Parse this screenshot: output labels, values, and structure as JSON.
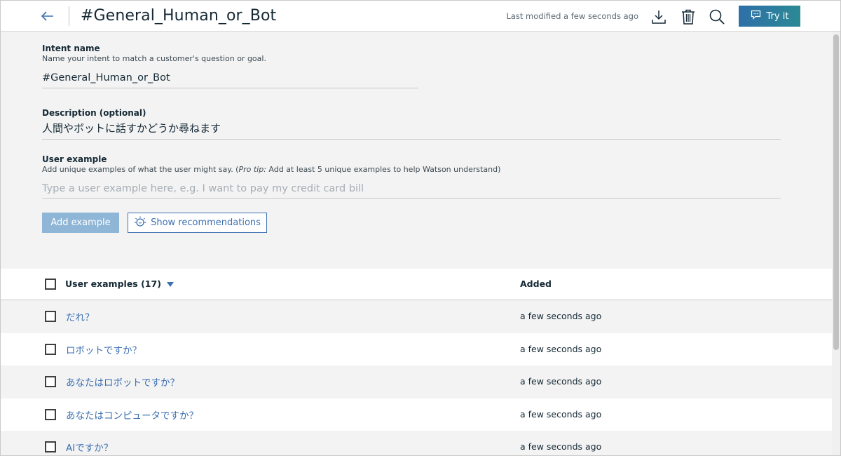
{
  "header": {
    "title": "#General_Human_or_Bot",
    "last_modified": "Last modified a few seconds ago",
    "try_label": "Try it",
    "icons": [
      "back-arrow-icon",
      "download-icon",
      "trash-icon",
      "search-icon",
      "chat-icon"
    ]
  },
  "form": {
    "intent_label": "Intent name",
    "intent_help": "Name your intent to match a customer's question or goal.",
    "intent_value": "#General_Human_or_Bot",
    "desc_label": "Description (optional)",
    "desc_value": "人間やボットに話すかどうか尋ねます",
    "example_label": "User example",
    "example_help_pre": "Add unique examples of what the user might say. (",
    "example_help_tip": "Pro tip:",
    "example_help_post": " Add at least 5 unique examples to help Watson understand)",
    "example_placeholder": "Type a user example here, e.g. I want to pay my credit card bill",
    "add_button": "Add example",
    "recommend_button": "Show recommendations"
  },
  "table": {
    "col_examples": "User examples (17)",
    "col_added": "Added",
    "rows": [
      {
        "text": "だれ？",
        "added": "a few seconds ago"
      },
      {
        "text": "ロボットですか？",
        "added": "a few seconds ago"
      },
      {
        "text": "あなたはロボットですか？",
        "added": "a few seconds ago"
      },
      {
        "text": "あなたはコンピュータですか？",
        "added": "a few seconds ago"
      },
      {
        "text": "AIですか？",
        "added": "a few seconds ago"
      }
    ]
  },
  "colors": {
    "accent": "#3d70b2",
    "try_button_start": "#2e6fa8",
    "try_button_end": "#2b8a95",
    "add_button_disabled": "#8fb6d6"
  }
}
